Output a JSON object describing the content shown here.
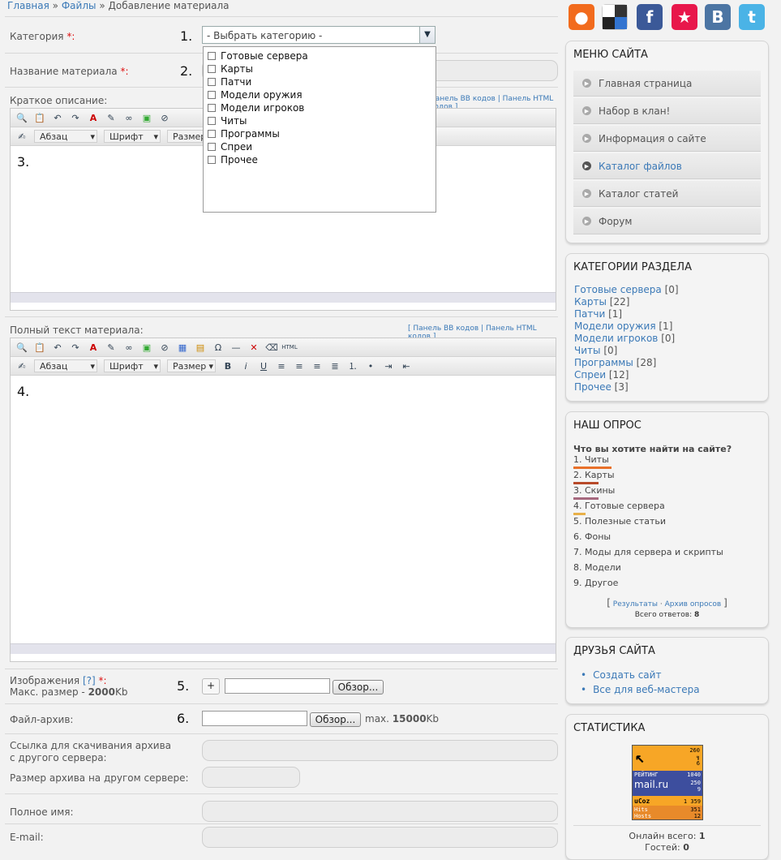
{
  "breadcrumb": {
    "home": "Главная",
    "sep1": "»",
    "files": "Файлы",
    "sep2": "»",
    "current": "Добавление материала"
  },
  "form": {
    "category_label": "Категория",
    "required_mark": "*:",
    "category_placeholder": "- Выбрать категорию -",
    "category_options": [
      "Готовые сервера",
      "Карты",
      "Патчи",
      "Модели оружия",
      "Модели игроков",
      "Читы",
      "Программы",
      "Спреи",
      "Прочее"
    ],
    "title_label": "Название материала",
    "short_label": "Краткое описание:",
    "full_label": "Полный текст материала:",
    "panel_bb": "Панель BB кодов",
    "panel_html": "Панель HTML кодов",
    "panel_sep": "|",
    "bracket_open": "[",
    "bracket_close": "]",
    "paragraph": "Абзац",
    "font": "Шрифт",
    "size": "Размер",
    "images_label": "Изображения",
    "images_help": "[?]",
    "images_max": "Макс. размер -",
    "images_max_value": "2000",
    "images_max_unit": "Kb",
    "add_btn": "+",
    "browse_btn": "Обзор...",
    "file_label": "Файл-архив:",
    "file_max_prefix": "max.",
    "file_max_value": "15000",
    "file_max_unit": "Kb",
    "ext_link_label": "Ссылка для скачивания архива с другого сервера:",
    "ext_size_label": "Размер архива на другом сервере:",
    "fullname_label": "Полное имя:",
    "email_label": "E-mail:"
  },
  "markers": [
    "1.",
    "2.",
    "3.",
    "4.",
    "5.",
    "6."
  ],
  "sidebar": {
    "menu_title": "МЕНЮ САЙТА",
    "menu": [
      "Главная страница",
      "Набор в клан!",
      "Информация о сайте",
      "Каталог файлов",
      "Каталог статей",
      "Форум"
    ],
    "menu_active_index": 3,
    "categories_title": "КАТЕГОРИИ РАЗДЕЛА",
    "categories": [
      {
        "name": "Готовые сервера",
        "count": "[0]"
      },
      {
        "name": "Карты",
        "count": "[22]"
      },
      {
        "name": "Патчи",
        "count": "[1]"
      },
      {
        "name": "Модели оружия",
        "count": "[1]"
      },
      {
        "name": "Модели игроков",
        "count": "[0]"
      },
      {
        "name": "Читы",
        "count": "[0]"
      },
      {
        "name": "Программы",
        "count": "[28]"
      },
      {
        "name": "Спреи",
        "count": "[12]"
      },
      {
        "name": "Прочее",
        "count": "[3]"
      }
    ],
    "poll_title": "НАШ ОПРОС",
    "poll_question": "Что вы хотите найти на сайте?",
    "poll_options": [
      "1. Читы",
      "2. Карты",
      "3. Скины",
      "4. Готовые сервера",
      "5. Полезные статьи",
      "6. Фоны",
      "7. Моды для сервера и скрипты",
      "8. Модели",
      "9. Другое"
    ],
    "poll_bar_colors": [
      "#e8702a",
      "#b84a2a",
      "#a6697e",
      "#e8b048"
    ],
    "poll_results": "Результаты",
    "poll_dot": "·",
    "poll_archive": "Архив опросов",
    "poll_total_label": "Всего ответов:",
    "poll_total": "8",
    "friends_title": "ДРУЗЬЯ САЙТА",
    "friends": [
      "Создать сайт",
      "Все для веб-мастера"
    ],
    "stats_title": "СТАТИСТИКА",
    "counter": {
      "top": [
        "260",
        "6"
      ],
      "rating_label": "РЕЙТИНГ",
      "rating_value": "1040",
      "mailru": "mail.ru",
      "mailru_nums": [
        "250",
        "9"
      ],
      "ucoz_label": "uCoz",
      "ucoz_value": "1 359",
      "hits_label": "Hits",
      "hits_value": "351",
      "hosts_label": "Hosts",
      "hosts_value": "12"
    },
    "online_label": "Онлайн всего:",
    "online_value": "1",
    "guests_label": "Гостей:",
    "guests_value": "0"
  },
  "social": [
    {
      "name": "rss-icon",
      "color": "#f26b1d",
      "glyph": "●"
    },
    {
      "name": "delicious-icon",
      "color": "#ffffff",
      "glyph": ""
    },
    {
      "name": "facebook-icon",
      "color": "#3b5998",
      "glyph": "f"
    },
    {
      "name": "memori-icon",
      "color": "#e8174b",
      "glyph": "★"
    },
    {
      "name": "vkontakte-icon",
      "color": "#4c75a3",
      "glyph": "B"
    },
    {
      "name": "twitter-icon",
      "color": "#4ab3e6",
      "glyph": "t"
    }
  ]
}
